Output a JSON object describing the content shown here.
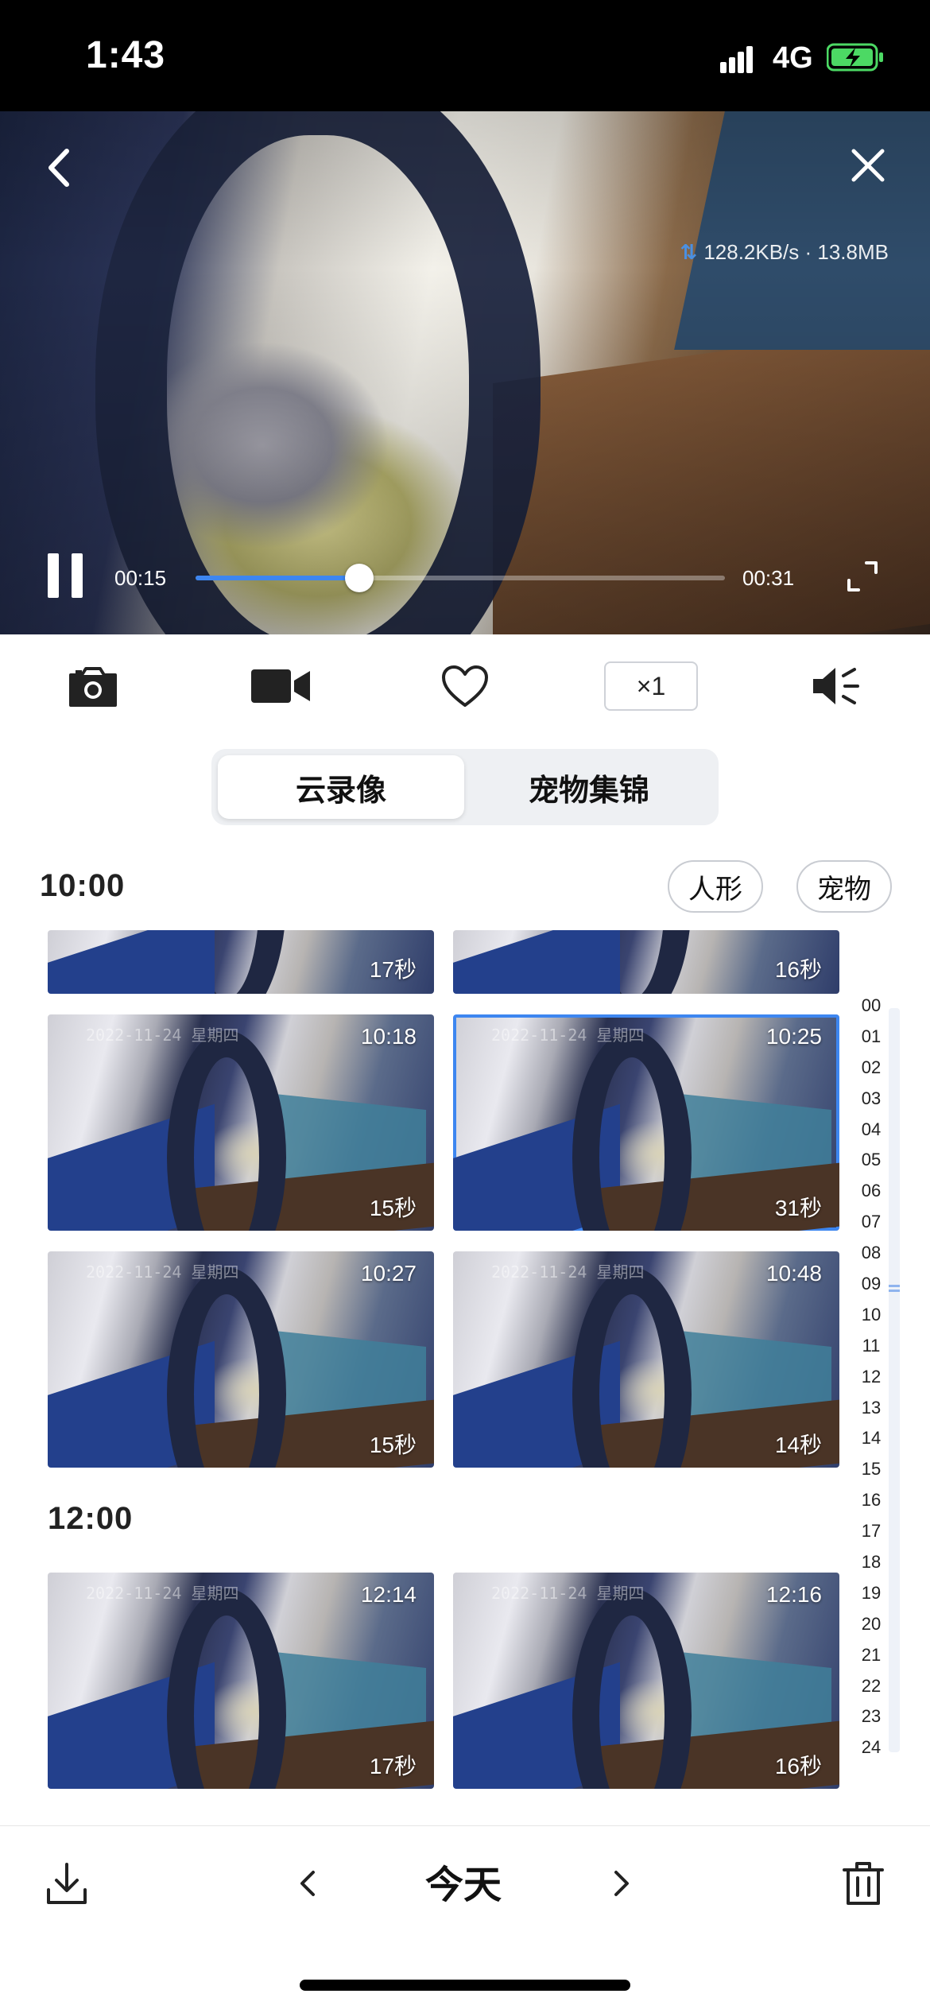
{
  "status_bar": {
    "time": "1:43",
    "network": "4G"
  },
  "player": {
    "speed_text": "128.2KB/s · 13.8MB",
    "current_time": "00:15",
    "total_time": "00:31",
    "progress": 0.31
  },
  "toolbar": {
    "speed_label": "×1"
  },
  "tabs": [
    {
      "label": "云录像",
      "active": true
    },
    {
      "label": "宠物集锦",
      "active": false
    }
  ],
  "filters": [
    "人形",
    "宠物"
  ],
  "sections": [
    {
      "hour": "10:00",
      "clips": [
        {
          "time": "",
          "duration": "17秒",
          "date": ""
        },
        {
          "time": "",
          "duration": "16秒",
          "date": ""
        },
        {
          "time": "10:18",
          "duration": "15秒",
          "date": "2022-11-24  星期四"
        },
        {
          "time": "10:25",
          "duration": "31秒",
          "date": "2022-11-24  星期四",
          "selected": true
        },
        {
          "time": "10:27",
          "duration": "15秒",
          "date": "2022-11-24  星期四"
        },
        {
          "time": "10:48",
          "duration": "14秒",
          "date": "2022-11-24  星期四"
        }
      ]
    },
    {
      "hour": "12:00",
      "clips": [
        {
          "time": "12:14",
          "duration": "17秒",
          "date": "2022-11-24  星期四"
        },
        {
          "time": "12:16",
          "duration": "16秒",
          "date": "2022-11-24  星期四"
        }
      ]
    }
  ],
  "hour_index": [
    "00",
    "01",
    "02",
    "03",
    "04",
    "05",
    "06",
    "07",
    "08",
    "09",
    "10",
    "11",
    "12",
    "13",
    "14",
    "15",
    "16",
    "17",
    "18",
    "19",
    "20",
    "21",
    "22",
    "23",
    "24"
  ],
  "bottom_bar": {
    "date_label": "今天"
  },
  "colors": {
    "accent": "#3d86f0",
    "battery": "#4cd964"
  }
}
